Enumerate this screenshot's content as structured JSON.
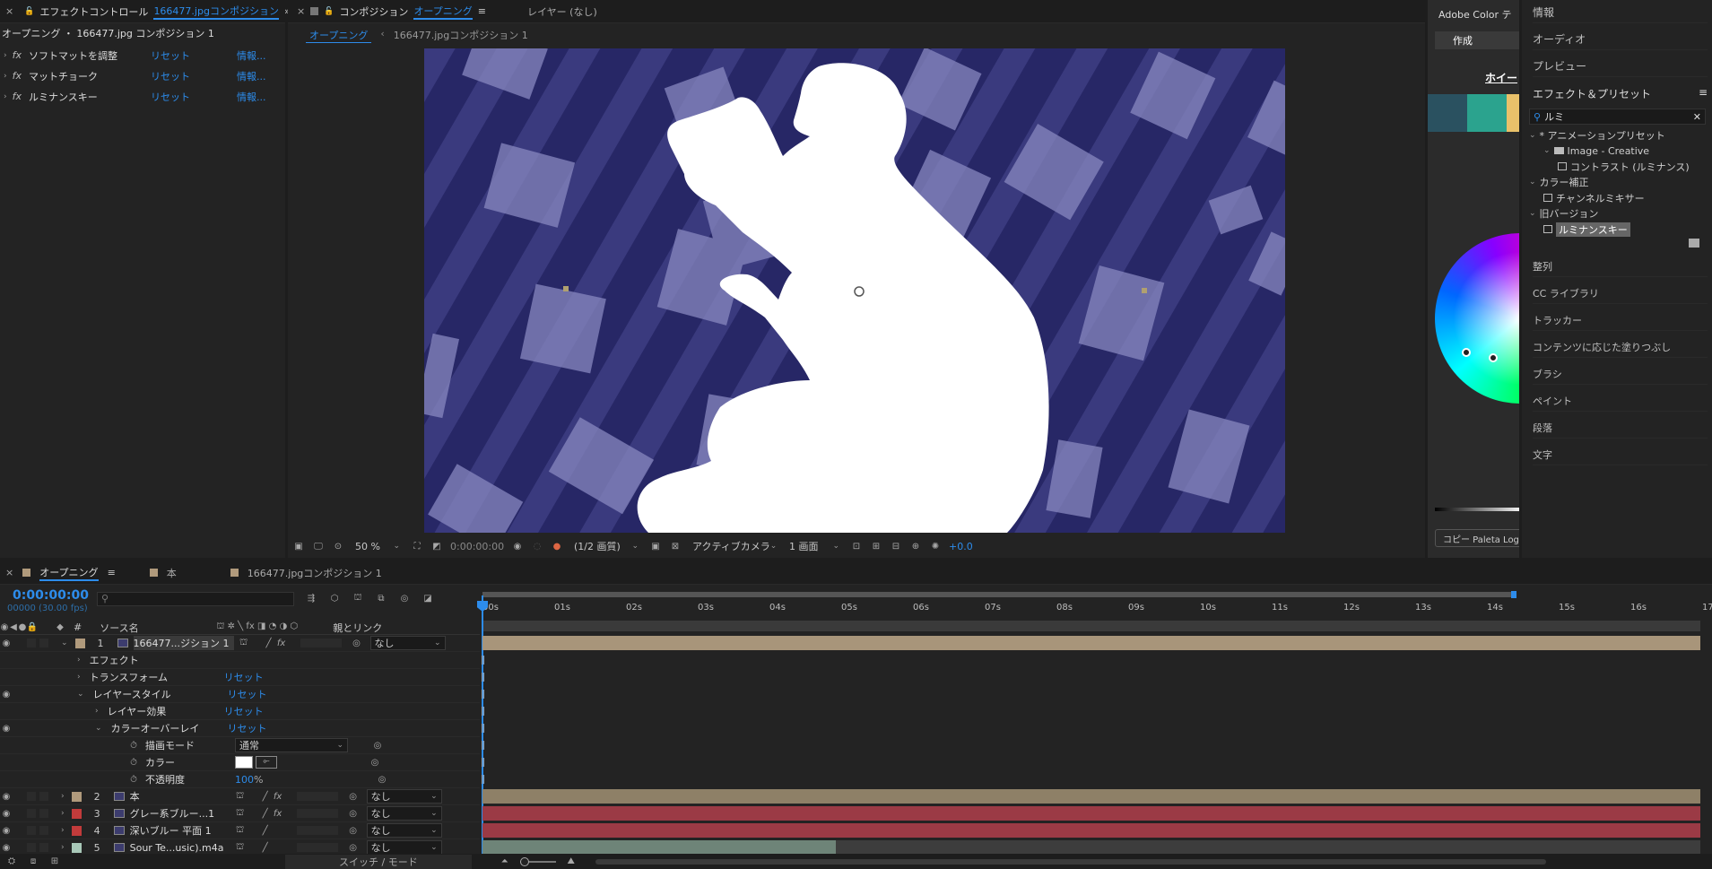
{
  "effect_controls": {
    "tab_label": "エフェクトコントロール",
    "tab_target": "166477.jpgコンポジション",
    "breadcrumb": "オープニング ・ 166477.jpg コンポジション 1",
    "effects": [
      {
        "name": "ソフトマットを調整",
        "reset": "リセット",
        "info": "情報..."
      },
      {
        "name": "マットチョーク",
        "reset": "リセット",
        "info": "情報..."
      },
      {
        "name": "ルミナンスキー",
        "reset": "リセット",
        "info": "情報..."
      }
    ]
  },
  "composition": {
    "tab_label": "コンポジション",
    "tab_name": "オープニング",
    "layer_tab": "レイヤー (なし)",
    "sub_tabs": [
      "オープニング",
      "166477.jpgコンポジション 1"
    ],
    "colors": {
      "bg": "#2a2a6a",
      "stripe": "#3b3b80",
      "book": "#8a8ac0"
    },
    "toolbar": {
      "zoom": "50 %",
      "time": "0:00:00:00",
      "resolution": "(1/2 画質)",
      "camera": "アクティブカメラ",
      "views": "1 画面",
      "exposure": "+0.0"
    }
  },
  "adobe_color": {
    "title": "Adobe Color テ",
    "tab_create": "作成",
    "wheel_label": "ホイー",
    "copy_button": "コピー Paleta Logo",
    "swatches": [
      "#2a5160",
      "#2ba38e",
      "#e9c16a"
    ]
  },
  "right_panel": {
    "items_top": [
      "情報",
      "オーディオ",
      "プレビュー"
    ],
    "effects_presets_title": "エフェクト＆プリセット",
    "search_value": "ルミ",
    "tree": [
      {
        "label": "* アニメーションプリセット",
        "indent": 0,
        "kind": "folder-open"
      },
      {
        "label": "Image - Creative",
        "indent": 1,
        "kind": "folder"
      },
      {
        "label": "コントラスト (ルミナンス)",
        "indent": 2,
        "kind": "effect"
      },
      {
        "label": "カラー補正",
        "indent": 0,
        "kind": "folder-open"
      },
      {
        "label": "チャンネルミキサー",
        "indent": 1,
        "kind": "effect"
      },
      {
        "label": "旧バージョン",
        "indent": 0,
        "kind": "folder-open"
      },
      {
        "label": "ルミナンスキー",
        "indent": 1,
        "kind": "effect",
        "selected": true
      }
    ],
    "items_bottom": [
      "整列",
      "CC ライブラリ",
      "トラッカー",
      "コンテンツに応じた塗りつぶし",
      "ブラシ",
      "ペイント",
      "段落",
      "文字"
    ]
  },
  "timeline": {
    "tabs": [
      "オープニング",
      "本",
      "166477.jpgコンポジション 1"
    ],
    "tab_colors": [
      "#b09a7c",
      "#b09a7c",
      "#b09a7c"
    ],
    "timecode": "0:00:00:00",
    "fps": "00000 (30.00 fps)",
    "columns": {
      "hash": "#",
      "source": "ソース名",
      "parent": "親とリンク"
    },
    "ruler": [
      "00s",
      "01s",
      "02s",
      "03s",
      "04s",
      "05s",
      "06s",
      "07s",
      "08s",
      "09s",
      "10s",
      "11s",
      "12s",
      "13s",
      "14s",
      "15s",
      "16s",
      "17"
    ],
    "layers": [
      {
        "num": "1",
        "name": "166477...ジション 1",
        "parent": "なし",
        "color": "#b09a7c",
        "bar_color": "#a8957a",
        "bar_start": 0,
        "bar_end": 1
      },
      {
        "num": "2",
        "name": "本",
        "parent": "なし",
        "color": "#b09a7c",
        "bar_color": "#8e8067",
        "bar_start": 0,
        "bar_end": 1
      },
      {
        "num": "3",
        "name": "グレー系ブルー...1",
        "parent": "なし",
        "color": "#c23b3b",
        "bar_color": "#9b3a45",
        "bar_start": 0,
        "bar_end": 1
      },
      {
        "num": "4",
        "name": "深いブルー 平面 1",
        "parent": "なし",
        "color": "#c23b3b",
        "bar_color": "#9b3a45",
        "bar_start": 0,
        "bar_end": 1
      },
      {
        "num": "5",
        "name": "Sour Te...usic).m4a",
        "parent": "なし",
        "color": "#a8c8b8",
        "bar_color": "#6e8478",
        "bar_start": 0,
        "bar_end": 0.29
      }
    ],
    "props": {
      "effects": "エフェクト",
      "transform": "トランスフォーム",
      "layer_style": "レイヤースタイル",
      "layer_effect": "レイヤー効果",
      "color_overlay": "カラーオーバーレイ",
      "blend_mode": "描画モード",
      "blend_value": "通常",
      "color": "カラー",
      "opacity": "不透明度",
      "opacity_value": "100",
      "opacity_unit": "%",
      "reset": "リセット"
    },
    "footer": "スイッチ / モード"
  }
}
